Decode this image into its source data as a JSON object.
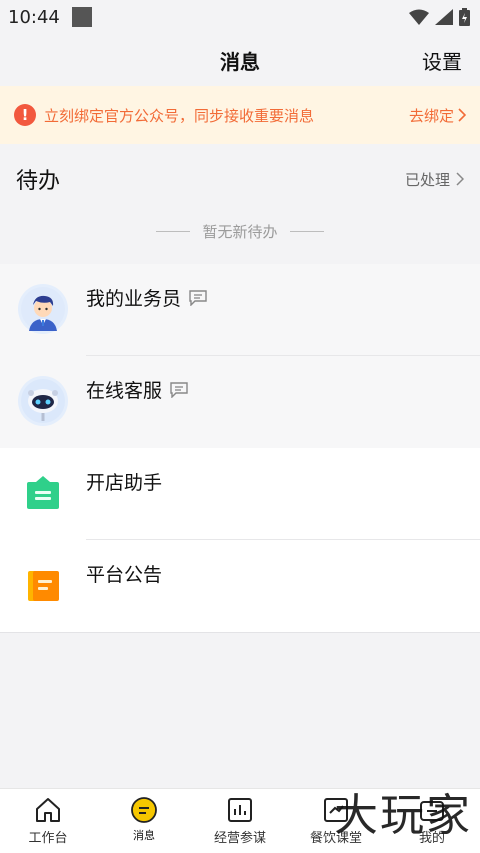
{
  "status_bar": {
    "time": "10:44"
  },
  "header": {
    "title": "消息",
    "settings_label": "设置"
  },
  "banner": {
    "text": "立刻绑定官方公众号，同步接收重要消息",
    "link_label": "去绑定"
  },
  "todo": {
    "title": "待办",
    "done_label": "已处理",
    "empty_text": "暂无新待办"
  },
  "messages": [
    {
      "label": "我的业务员",
      "icon": "salesperson-avatar-icon",
      "has_msg_icon": true
    },
    {
      "label": "在线客服",
      "icon": "robot-avatar-icon",
      "has_msg_icon": true
    },
    {
      "label": "开店助手",
      "icon": "shop-assistant-icon",
      "has_msg_icon": false
    },
    {
      "label": "平台公告",
      "icon": "announcement-icon",
      "has_msg_icon": false
    }
  ],
  "bottom_nav": [
    {
      "label": "工作台",
      "icon": "home-icon"
    },
    {
      "label": "消息",
      "icon": "message-icon",
      "active": true
    },
    {
      "label": "经营参谋",
      "icon": "chart-icon"
    },
    {
      "label": "餐饮课堂",
      "icon": "course-icon"
    },
    {
      "label": "我的",
      "icon": "profile-icon"
    }
  ],
  "watermark": "大玩家",
  "colors": {
    "accent": "#f2c100",
    "banner_text": "#f26b37",
    "banner_bg": "#fff5e3"
  }
}
